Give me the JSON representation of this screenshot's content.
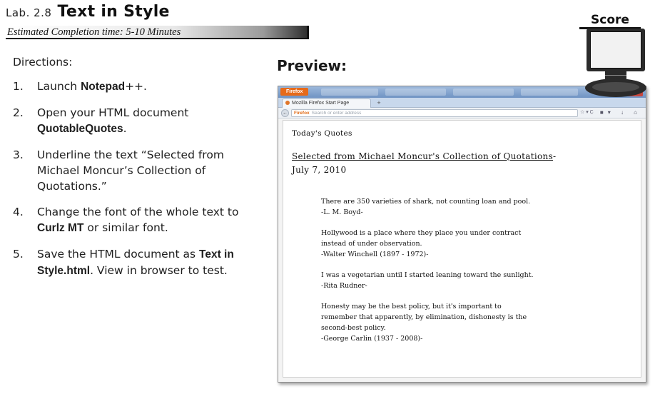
{
  "header": {
    "lab_number": "Lab. 2.8",
    "title": "Text in Style",
    "estimated_time": "Estimated Completion time: 5-10 Minutes"
  },
  "directions": {
    "title": "Directions:",
    "steps": [
      {
        "num": "1.",
        "pre": "Launch ",
        "bold": "Notepad",
        "post": "++."
      },
      {
        "num": "2.",
        "pre": "Open your HTML document ",
        "bold": "QuotableQuotes",
        "post": "."
      },
      {
        "num": "3.",
        "text": "Underline the text “Selected from Michael Moncur’s Collection of Quotations.”"
      },
      {
        "num": "4.",
        "pre": "Change the font of the whole text to ",
        "bold": "Curlz MT",
        "post": " or similar font."
      },
      {
        "num": "5.",
        "pre": "Save the HTML document as ",
        "bold": "Text in Style.html",
        "post": ". View in browser to test."
      }
    ]
  },
  "preview_label": "Preview:",
  "score_label": "Score",
  "browser": {
    "menu_label": "Firefox",
    "tab_title": "Mozilla Firefox Start Page",
    "new_tab": "+",
    "back": "←",
    "url_badge": "Firefox",
    "url_placeholder": "Search or enter address",
    "url_controls": "☆ ▾ C",
    "nav_icons": "■▾ ↓ ⌂",
    "close": "✕",
    "content": {
      "heading": "Today's Quotes",
      "selected_underlined": "Selected from Michael Moncur's Collection of Quotations",
      "selected_rest": "-",
      "date": "July 7, 2010",
      "quotes": [
        {
          "lines": [
            "There are 350 varieties of shark, not counting loan and pool.",
            "-L. M. Boyd-"
          ]
        },
        {
          "lines": [
            "Hollywood is a place where they place you under contract",
            "instead of under observation.",
            "-Walter Winchell (1897 - 1972)-"
          ]
        },
        {
          "lines": [
            "I was a vegetarian until I started leaning toward the sunlight.",
            "-Rita Rudner-"
          ]
        },
        {
          "lines": [
            "Honesty may be the best policy, but it's important to",
            "remember that apparently, by elimination, dishonesty is the",
            "second-best policy.",
            "-George Carlin (1937 - 2008)-"
          ]
        }
      ]
    }
  }
}
